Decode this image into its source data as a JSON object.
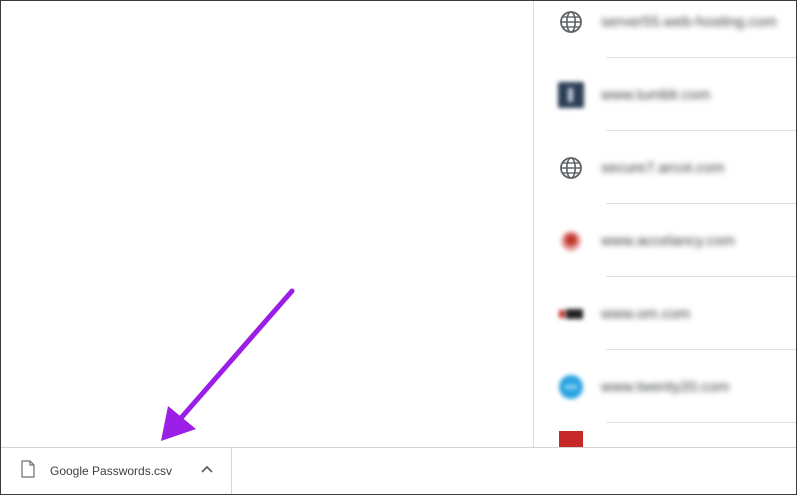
{
  "passwords_list": {
    "items": [
      {
        "site": "server55.web-hosting.com",
        "icon": "globe-icon"
      },
      {
        "site": "www.tumblr.com",
        "icon": "tumblr-icon"
      },
      {
        "site": "secure7.arcot.com",
        "icon": "globe-icon"
      },
      {
        "site": "www.accelancy.com",
        "icon": "accelancy-icon"
      },
      {
        "site": "www.om.com",
        "icon": "om-icon"
      },
      {
        "site": "www.twenty20.com",
        "icon": "twenty20-icon"
      },
      {
        "site": "",
        "icon": "red-favicon"
      }
    ]
  },
  "download_bar": {
    "file_name": "Google Passwords.csv",
    "file_icon": "document-icon",
    "menu_icon": "chevron-up-icon"
  },
  "annotation": {
    "arrow_color": "#9b1ee6"
  }
}
